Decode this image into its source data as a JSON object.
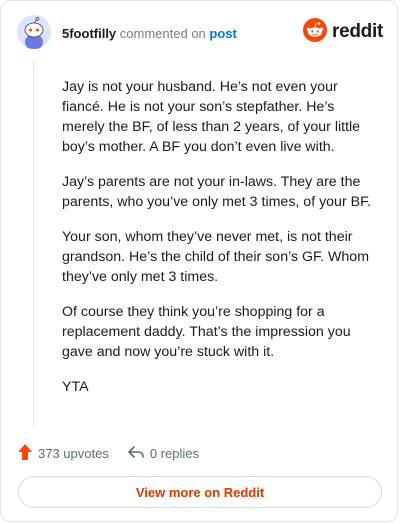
{
  "header": {
    "username": "5footfilly",
    "verb": "commented on",
    "post_link": "post",
    "brand": "reddit"
  },
  "comment": {
    "paragraphs": [
      "Jay is not your husband. He’s not even your fiancé. He is not your son’s stepfather. He’s merely the BF, of less than 2 years, of your little boy’s mother. A BF you don’t even live with.",
      "Jay’s parents are not your in-laws. They are the parents, who you’ve only met 3 times, of your BF.",
      "Your son, whom they’ve never met, is not their grandson. He’s the child of their son’s GF. Whom they’ve only met 3 times.",
      "Of course they think you’re shopping for a replacement daddy. That’s the impression you gave and now you’re stuck with it.",
      "YTA"
    ]
  },
  "actions": {
    "upvotes": "373 upvotes",
    "replies": "0 replies"
  },
  "footer": {
    "view_more": "View more on Reddit"
  },
  "colors": {
    "upvote": "#ff4500",
    "link": "#0079d3",
    "view_more": "#d93a00",
    "brand": "#ff4500"
  },
  "icons": {
    "avatar": "snoo-avatar-icon",
    "brand": "reddit-logo-icon",
    "upvote": "upvote-arrow-icon",
    "reply": "reply-arrow-icon"
  }
}
